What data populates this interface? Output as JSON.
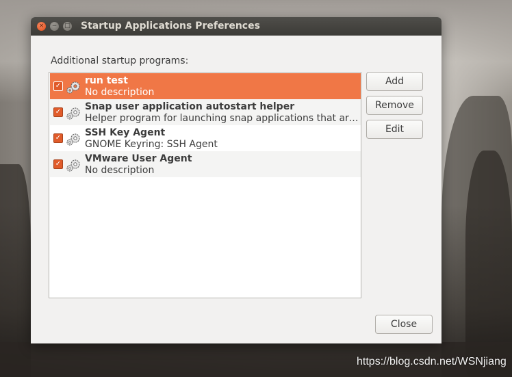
{
  "window": {
    "title": "Startup Applications Preferences",
    "close_glyph": "×",
    "minimize_glyph": "−",
    "maximize_glyph": "□"
  },
  "content": {
    "heading": "Additional startup programs:"
  },
  "programs": [
    {
      "name": "run test",
      "description": "No description",
      "enabled": true,
      "selected": true,
      "icon": "gears-icon"
    },
    {
      "name": "Snap user application autostart helper",
      "description": "Helper program for launching snap applications that are…",
      "enabled": true,
      "selected": false,
      "icon": "gears-icon"
    },
    {
      "name": "SSH Key Agent",
      "description": "GNOME Keyring: SSH Agent",
      "enabled": true,
      "selected": false,
      "icon": "gears-icon"
    },
    {
      "name": "VMware User Agent",
      "description": "No description",
      "enabled": true,
      "selected": false,
      "icon": "gears-icon"
    }
  ],
  "buttons": {
    "add": "Add",
    "remove": "Remove",
    "edit": "Edit",
    "close": "Close"
  },
  "checkmark_glyph": "✓",
  "watermark": "https://blog.csdn.net/WSNjiang",
  "colors": {
    "accent": "#f07746",
    "titlebar": "#3c3b37",
    "window_bg": "#f2f1f0"
  }
}
